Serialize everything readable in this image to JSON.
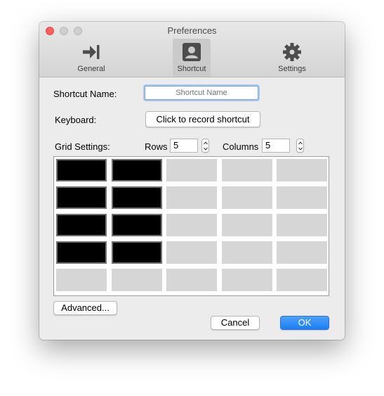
{
  "window": {
    "title": "Preferences"
  },
  "toolbar": {
    "items": [
      {
        "label": "General",
        "icon": "arrow-to-line-icon",
        "selected": false
      },
      {
        "label": "Shortcut",
        "icon": "contact-card-icon",
        "selected": true
      },
      {
        "label": "Settings",
        "icon": "gear-icon",
        "selected": false
      }
    ]
  },
  "form": {
    "shortcut_name_label": "Shortcut Name:",
    "shortcut_name_placeholder": "Shortcut Name",
    "shortcut_name_value": "",
    "keyboard_label": "Keyboard:",
    "record_button": "Click to record shortcut",
    "grid_settings_label": "Grid Settings:",
    "rows_label": "Rows",
    "rows_value": "5",
    "columns_label": "Columns",
    "columns_value": "5"
  },
  "grid": {
    "rows": 5,
    "columns": 5,
    "selected": [
      [
        true,
        true,
        false,
        false,
        false
      ],
      [
        true,
        true,
        false,
        false,
        false
      ],
      [
        true,
        true,
        false,
        false,
        false
      ],
      [
        true,
        true,
        false,
        false,
        false
      ],
      [
        false,
        false,
        false,
        false,
        false
      ]
    ]
  },
  "footer": {
    "advanced_button": "Advanced...",
    "cancel_button": "Cancel",
    "ok_button": "OK"
  },
  "colors": {
    "accent": "#1b7ef5",
    "cell_selected": "#000000",
    "cell_empty": "#d6d6d6"
  }
}
